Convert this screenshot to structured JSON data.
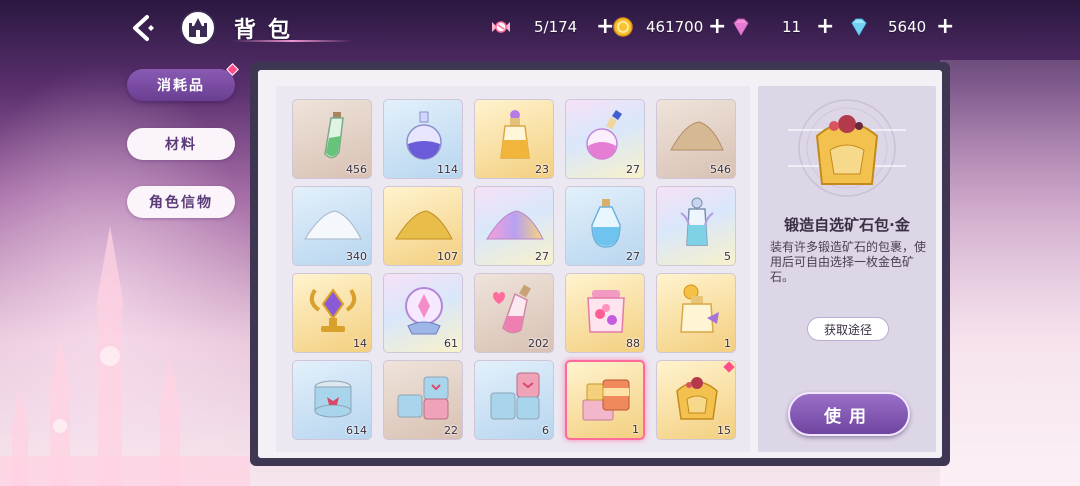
{
  "header": {
    "title": "背包"
  },
  "resources": [
    {
      "icon": "candy-icon",
      "value": "5/174"
    },
    {
      "icon": "gold-coin-icon",
      "value": "461700"
    },
    {
      "icon": "pink-gem-icon",
      "value": "11"
    },
    {
      "icon": "blue-diamond-icon",
      "value": "5640"
    }
  ],
  "tabs": [
    {
      "label": "消耗品",
      "active": true
    },
    {
      "label": "材料",
      "active": false
    },
    {
      "label": "角色信物",
      "active": false
    }
  ],
  "items": [
    {
      "count": "456",
      "icon": "green-potion-icon"
    },
    {
      "count": "114",
      "icon": "purple-potion-icon"
    },
    {
      "count": "23",
      "icon": "gold-potion-icon"
    },
    {
      "count": "27",
      "icon": "rainbow-potion-icon"
    },
    {
      "count": "546",
      "icon": "sand-pile-icon"
    },
    {
      "count": "340",
      "icon": "white-powder-icon"
    },
    {
      "count": "107",
      "icon": "gold-powder-icon"
    },
    {
      "count": "27",
      "icon": "rainbow-powder-icon"
    },
    {
      "count": "27",
      "icon": "blue-bottle-icon"
    },
    {
      "count": "5",
      "icon": "ornate-vial-icon"
    },
    {
      "count": "14",
      "icon": "gold-trophy-icon"
    },
    {
      "count": "61",
      "icon": "crystal-orb-icon"
    },
    {
      "count": "202",
      "icon": "heart-bottle-icon"
    },
    {
      "count": "88",
      "icon": "heart-jar-icon"
    },
    {
      "count": "1",
      "icon": "perfume-icon"
    },
    {
      "count": "614",
      "icon": "single-can-icon"
    },
    {
      "count": "22",
      "icon": "can-stack-icon"
    },
    {
      "count": "6",
      "icon": "can-tower-icon"
    },
    {
      "count": "1",
      "icon": "can-gift-set-icon"
    },
    {
      "count": "15",
      "icon": "ore-pack-gold-icon"
    }
  ],
  "detail": {
    "name": "锻造自选矿石包·金",
    "description": "装有许多锻造矿石的包裹，使用后可自由选择一枚金色矿石。",
    "source_button": "获取途径",
    "use_button": "使用"
  }
}
